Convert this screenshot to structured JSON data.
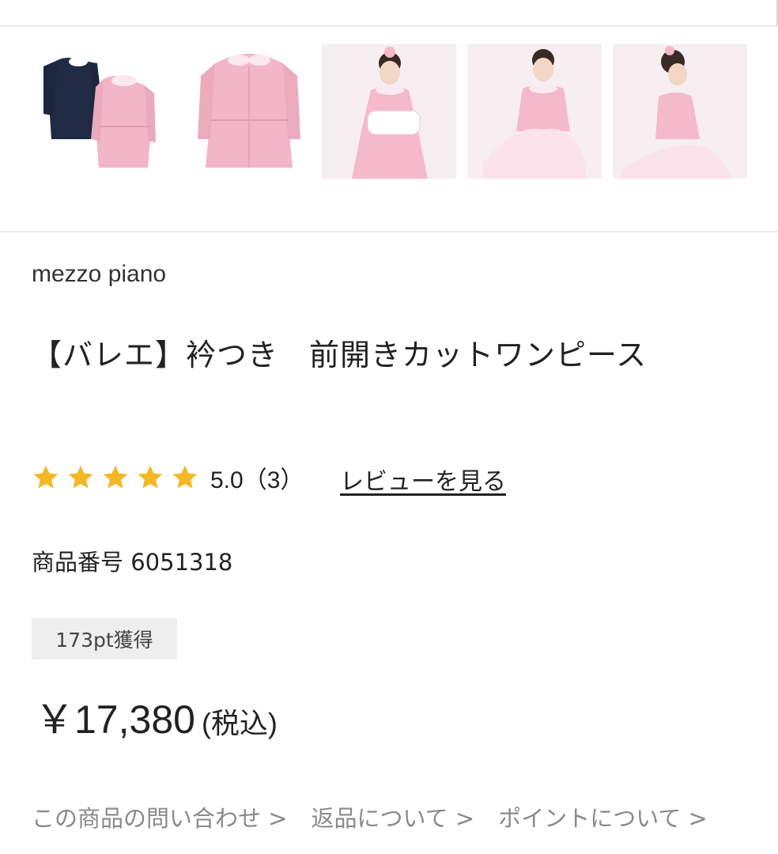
{
  "product": {
    "brand": "mezzo piano",
    "title": "【バレエ】衿つき　前開きカットワンピース",
    "rating": {
      "stars": 5,
      "value_text": "5.0（3）",
      "review_link": "レビューを見る"
    },
    "product_number": "商品番号 6051318",
    "points_badge": "173pt獲得",
    "price": {
      "amount": "￥17,380",
      "tax_note": "(税込)"
    }
  },
  "thumbnails": [
    {
      "name": "navy-and-pink-dresses"
    },
    {
      "name": "pink-dress"
    },
    {
      "name": "girl-holding-bag"
    },
    {
      "name": "girl-tulle-skirt"
    },
    {
      "name": "girl-side-view"
    }
  ],
  "footer_links": [
    "この商品の問い合わせ >",
    "返品について >",
    "ポイントについて >"
  ],
  "colors": {
    "star": "#f3b824",
    "badge_bg": "#eeeeee",
    "link_gray": "#8a8a8a",
    "dress_pink": "#f2b6c7",
    "dress_navy": "#1f2a45"
  }
}
